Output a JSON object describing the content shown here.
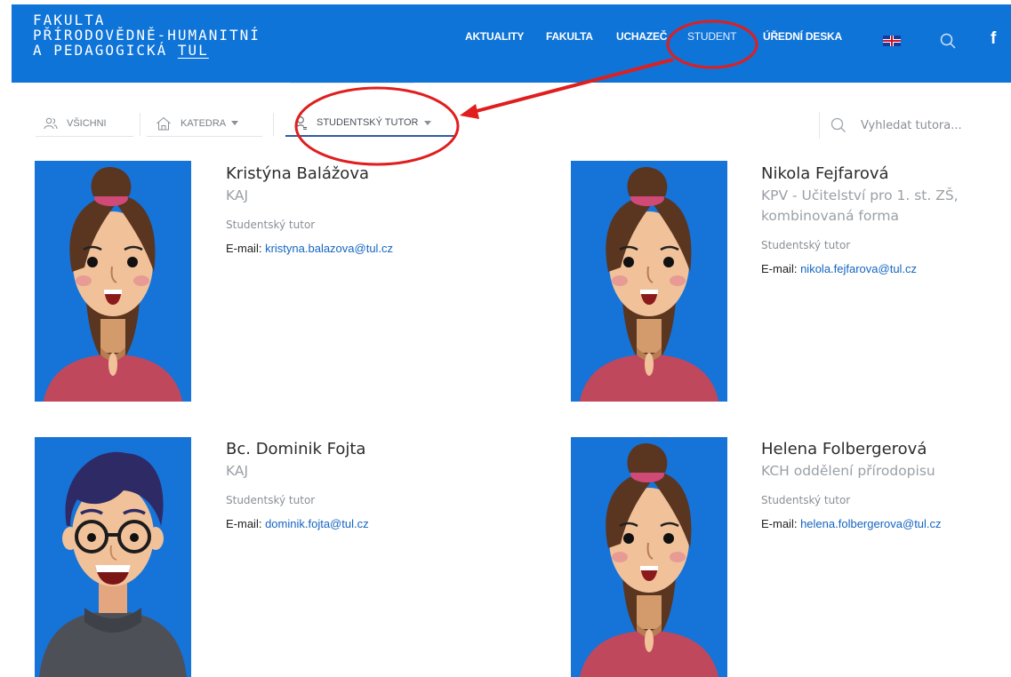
{
  "header": {
    "logo_line1": "FAKULTA",
    "logo_line2": "PŘÍRODOVĚDNĚ-HUMANITNÍ",
    "logo_line3_prefix": "A PEDAGOGICKÁ ",
    "logo_line3_tul": "TUL",
    "nav": [
      "AKTUALITY",
      "FAKULTA",
      "UCHAZEČ",
      "STUDENT",
      "ÚŘEDNÍ DESKA"
    ],
    "facebook": "f"
  },
  "filters": {
    "all_label": "VŠICHNI",
    "katedra_label": "KATEDRA",
    "tutor_label": "STUDENTSKÝ TUTOR"
  },
  "search": {
    "placeholder": "Vyhledat tutora..."
  },
  "tutors": [
    {
      "name": "Kristýna Balážova",
      "dept": "KAJ",
      "role": "Studentský tutor",
      "email_label": "E-mail:",
      "email": "kristyna.balazova@tul.cz"
    },
    {
      "name": "Nikola Fejfarová",
      "dept": "KPV - Učitelství pro 1. st. ZŠ, kombinovaná forma",
      "role": "Studentský tutor",
      "email_label": "E-mail:",
      "email": "nikola.fejfarova@tul.cz"
    },
    {
      "name": "Bc. Dominik Fojta",
      "dept": "KAJ",
      "role": "Studentský tutor",
      "email_label": "E-mail:",
      "email": "dominik.fojta@tul.cz"
    },
    {
      "name": "Helena Folbergerová",
      "dept": "KCH oddělení přírodopisu",
      "role": "Studentský tutor",
      "email_label": "E-mail:",
      "email": "helena.folbergerova@tul.cz"
    }
  ],
  "colors": {
    "brand_blue": "#0e74d8",
    "link_blue": "#1565c0",
    "annotation_red": "#e01e1e",
    "active_underline": "#2f5aa8"
  },
  "icons": [
    "users-icon",
    "home-icon",
    "user-icon",
    "search-icon",
    "flag-uk-icon",
    "facebook-icon"
  ]
}
